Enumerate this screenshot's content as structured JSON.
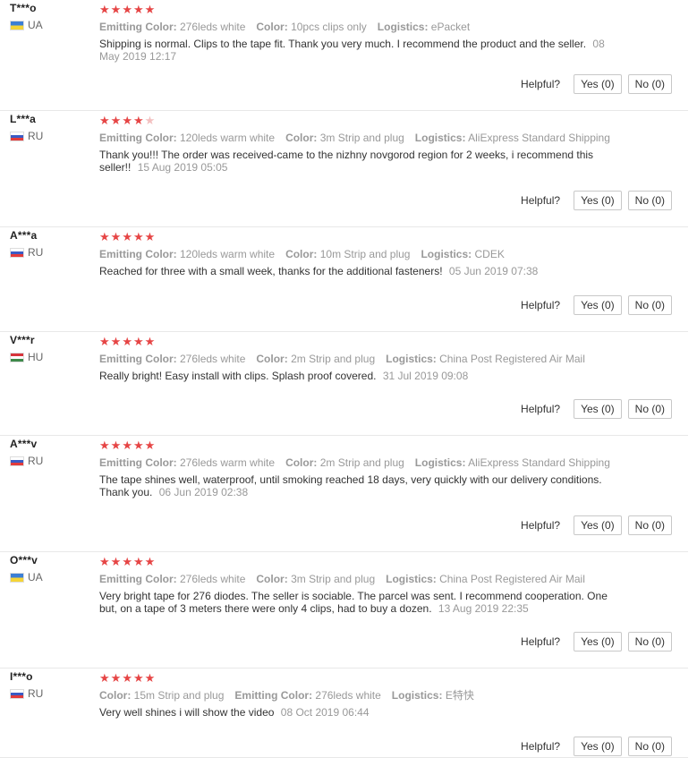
{
  "helpful_label": "Helpful?",
  "reviews": [
    {
      "user": "T***o",
      "country": "UA",
      "rating": 5,
      "attrs": [
        {
          "label": "Emitting Color:",
          "value": "276leds white"
        },
        {
          "label": "Color:",
          "value": "10pcs clips only"
        },
        {
          "label": "Logistics:",
          "value": "ePacket"
        }
      ],
      "text": "Shipping is normal. Clips to the tape fit. Thank you very much. I recommend the product and the seller.",
      "date": "08 May 2019 12:17",
      "yes": "Yes (0)",
      "no": "No (0)"
    },
    {
      "user": "L***a",
      "country": "RU",
      "rating": 4.5,
      "attrs": [
        {
          "label": "Emitting Color:",
          "value": "120leds warm white"
        },
        {
          "label": "Color:",
          "value": "3m Strip and plug"
        },
        {
          "label": "Logistics:",
          "value": "AliExpress Standard Shipping"
        }
      ],
      "text": "Thank you!!! The order was received-came to the nizhny novgorod region for 2 weeks, i recommend this seller!!",
      "date": "15 Aug 2019 05:05",
      "yes": "Yes (0)",
      "no": "No (0)"
    },
    {
      "user": "A***a",
      "country": "RU",
      "rating": 5,
      "attrs": [
        {
          "label": "Emitting Color:",
          "value": "120leds warm white"
        },
        {
          "label": "Color:",
          "value": "10m Strip and plug"
        },
        {
          "label": "Logistics:",
          "value": "CDEK"
        }
      ],
      "text": "Reached for three with a small week, thanks for the additional fasteners!",
      "date": "05 Jun 2019 07:38",
      "yes": "Yes (0)",
      "no": "No (0)"
    },
    {
      "user": "V***r",
      "country": "HU",
      "rating": 5,
      "attrs": [
        {
          "label": "Emitting Color:",
          "value": "276leds white"
        },
        {
          "label": "Color:",
          "value": "2m Strip and plug"
        },
        {
          "label": "Logistics:",
          "value": "China Post Registered Air Mail"
        }
      ],
      "text": "Really bright! Easy install with clips. Splash proof covered.",
      "date": "31 Jul 2019 09:08",
      "yes": "Yes (0)",
      "no": "No (0)"
    },
    {
      "user": "A***v",
      "country": "RU",
      "rating": 5,
      "attrs": [
        {
          "label": "Emitting Color:",
          "value": "276leds warm white"
        },
        {
          "label": "Color:",
          "value": "2m Strip and plug"
        },
        {
          "label": "Logistics:",
          "value": "AliExpress Standard Shipping"
        }
      ],
      "text": "The tape shines well, waterproof, until smoking reached 18 days, very quickly with our delivery conditions. Thank you.",
      "date": "06 Jun 2019 02:38",
      "yes": "Yes (0)",
      "no": "No (0)"
    },
    {
      "user": "O***v",
      "country": "UA",
      "rating": 5,
      "attrs": [
        {
          "label": "Emitting Color:",
          "value": "276leds white"
        },
        {
          "label": "Color:",
          "value": "3m Strip and plug"
        },
        {
          "label": "Logistics:",
          "value": "China Post Registered Air Mail"
        }
      ],
      "text": "Very bright tape for 276 diodes. The seller is sociable. The parcel was sent. I recommend cooperation. One but, on a tape of 3 meters there were only 4 clips, had to buy a dozen.",
      "date": "13 Aug 2019 22:35",
      "yes": "Yes (0)",
      "no": "No (0)"
    },
    {
      "user": "I***o",
      "country": "RU",
      "rating": 5,
      "attrs": [
        {
          "label": "Color:",
          "value": "15m Strip and plug"
        },
        {
          "label": "Emitting Color:",
          "value": "276leds white"
        },
        {
          "label": "Logistics:",
          "value": "E特快"
        }
      ],
      "text": "Very well shines i will show the video",
      "date": "08 Oct 2019 06:44",
      "yes": "Yes (0)",
      "no": "No (0)"
    }
  ]
}
